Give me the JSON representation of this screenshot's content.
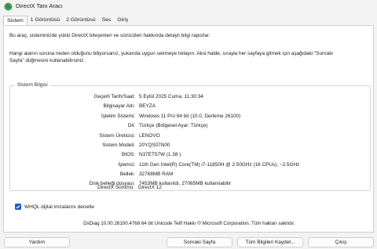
{
  "window": {
    "title": "DirectX Tanı Aracı"
  },
  "tabs": [
    {
      "label": "Sistem"
    },
    {
      "label": "1 Görüntüsü"
    },
    {
      "label": "2 Görüntüsü"
    },
    {
      "label": "Ses"
    },
    {
      "label": "Giriş"
    }
  ],
  "intro": {
    "line1": "Bu araç, sisteminizde yüklü DirectX bileşenleri ve sürücüleri hakkında detaylı bilgi raporlar.",
    "line2": "Hangi alanın soruna neden olduğunu biliyorsanız, yukarıda uygun sekmeye tıklayın. Aksi halde, sırayla her sayfaya gitmek için aşağıdaki \"Sonraki Sayfa\" düğmesini kullanabilirsiniz."
  },
  "system_info": {
    "title": "Sistem Bilgisi",
    "rows": [
      {
        "label": "Geçerli Tarih/Saat:",
        "value": "5 Eylül 2025 Cuma, 11:30:34"
      },
      {
        "label": "Bilgisayar Adı:",
        "value": "BEYZA"
      },
      {
        "label": "İşletim Sistemi:",
        "value": "Windows 11 Pro 64 bit (10.0, Derleme 26100)"
      },
      {
        "label": "Dil:",
        "value": "Türkçe (Bölgesel Ayar: Türkçe)"
      },
      {
        "label": "Sistem Üreticisi:",
        "value": "LENOVO"
      },
      {
        "label": "Sistem Modeli:",
        "value": "20YQS07N00"
      },
      {
        "label": "BIOS:",
        "value": "N37ET57W (1.38 )"
      },
      {
        "label": "İşlemci:",
        "value": "11th Gen Intel(R) Core(TM) i7-11850H @ 2.50GHz (16 CPUs), ~2.5GHz"
      },
      {
        "label": "Bellek:",
        "value": "32768MB RAM"
      },
      {
        "label": "Disk belleği dosyası:",
        "value": "7453MB kullanıldı, 27065MB kullanılabilir"
      },
      {
        "label": "DirectX Sürümü:",
        "value": "DirectX 12"
      }
    ]
  },
  "whql": {
    "label": "WHQL dijital imzalarını denetle",
    "checked": true
  },
  "footer": {
    "text": "DxDiag 10.00.26100.4768 64 bit Unicode   Telif Hakkı © Microsoft Corporation. Tüm hakları saklıdır."
  },
  "buttons": {
    "help": "Yardım",
    "next": "Sonraki Sayfa",
    "save_all": "Tüm Bilgileri Kaydet...",
    "exit": "Çıkış"
  },
  "colors": {
    "accent": "#1f5fbf",
    "window_bg": "#f3f3f3",
    "panel_bg": "#ffffff"
  }
}
